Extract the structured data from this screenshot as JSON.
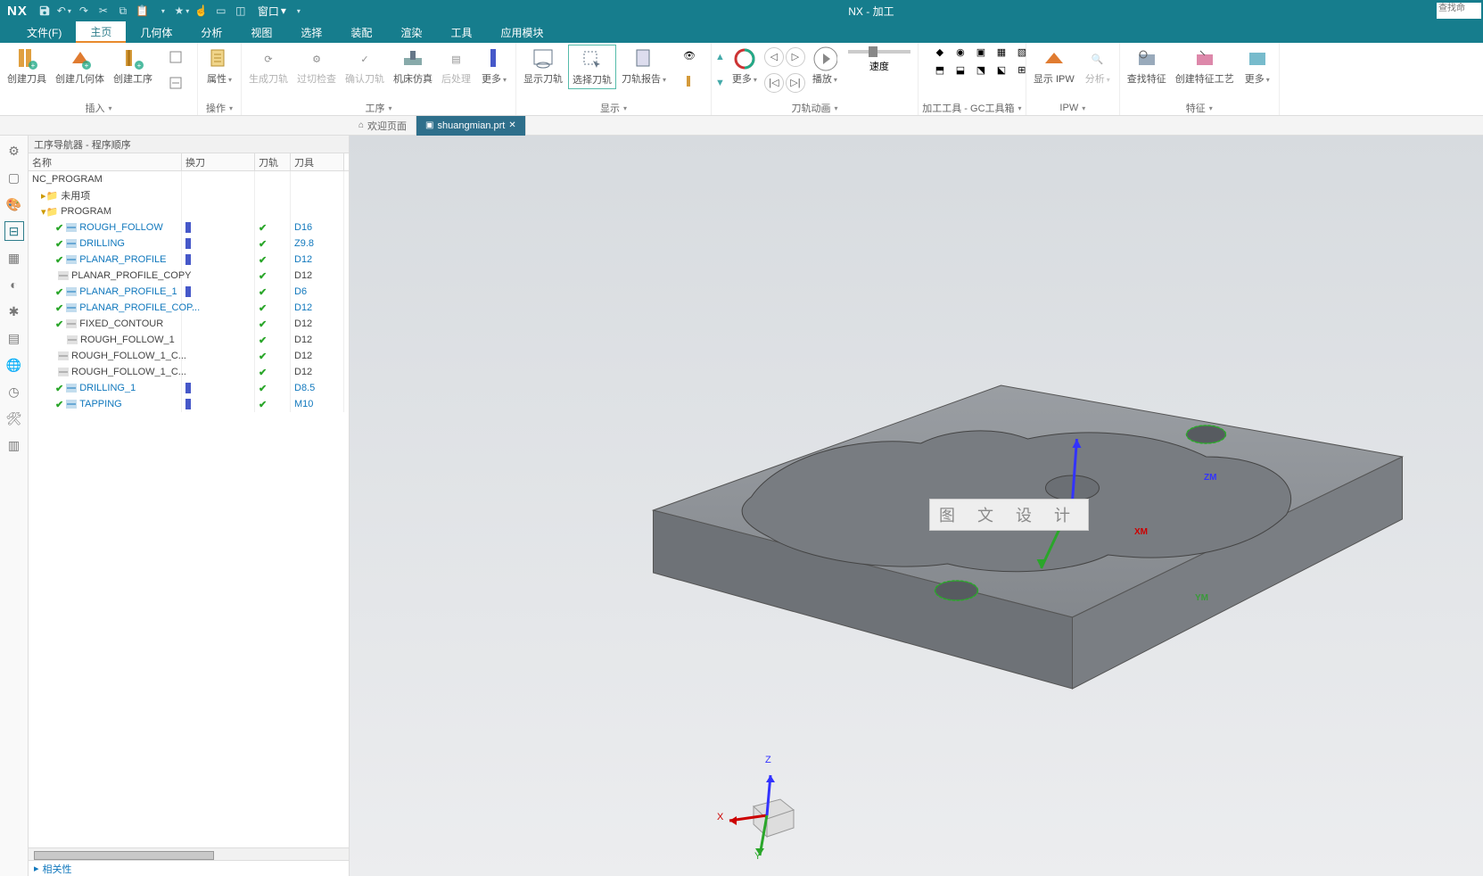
{
  "title": "NX - 加工",
  "nx_logo": "NX",
  "window_dropdown": "窗口",
  "search_placeholder": "查找命",
  "menus": [
    "文件(F)",
    "主页",
    "几何体",
    "分析",
    "视图",
    "选择",
    "装配",
    "渲染",
    "工具",
    "应用模块"
  ],
  "ribbon_groups": {
    "insert": {
      "label": "插入",
      "create_tool": "创建刀具",
      "create_geom": "创建几何体",
      "create_op": "创建工序"
    },
    "action": {
      "label": "操作",
      "props": "属性"
    },
    "ops": {
      "label": "工序",
      "gen": "生成刀轨",
      "gouge": "过切检查",
      "verify": "确认刀轨",
      "sim": "机床仿真",
      "post": "后处理",
      "more": "更多"
    },
    "display": {
      "label": "显示",
      "show_tp": "显示刀轨",
      "select_tp": "选择刀轨",
      "tp_report": "刀轨报告"
    },
    "anim": {
      "label": "刀轨动画",
      "more": "更多",
      "speed": "速度",
      "play": "播放"
    },
    "gctools": {
      "label": "加工工具 - GC工具箱"
    },
    "ipw": {
      "label": "IPW",
      "show_ipw": "显示 IPW",
      "analyze": "分析"
    },
    "feature": {
      "label": "特征",
      "find": "查找特征",
      "teach": "创建特征工艺",
      "more": "更多"
    }
  },
  "tabs": {
    "welcome": "欢迎页面",
    "active": "shuangmian.prt"
  },
  "navigator": {
    "title": "工序导航器 - 程序顺序",
    "cols": {
      "name": "名称",
      "toolchange": "换刀",
      "toolpath": "刀轨",
      "tool": "刀具"
    },
    "root": "NC_PROGRAM",
    "unused": "未用项",
    "program": "PROGRAM",
    "rows": [
      {
        "name": "ROUGH_FOLLOW",
        "tc": true,
        "tp": true,
        "tool": "D16",
        "link": true,
        "chk": true
      },
      {
        "name": "DRILLING",
        "tc": true,
        "tp": true,
        "tool": "Z9.8",
        "link": true,
        "chk": true
      },
      {
        "name": "PLANAR_PROFILE",
        "tc": true,
        "tp": true,
        "tool": "D12",
        "link": true,
        "chk": true
      },
      {
        "name": "PLANAR_PROFILE_COPY",
        "tc": false,
        "tp": true,
        "tool": "D12",
        "link": false,
        "chk": false
      },
      {
        "name": "PLANAR_PROFILE_1",
        "tc": true,
        "tp": true,
        "tool": "D6",
        "link": true,
        "chk": true
      },
      {
        "name": "PLANAR_PROFILE_COP...",
        "tc": false,
        "tp": true,
        "tool": "D12",
        "link": true,
        "chk": true
      },
      {
        "name": "FIXED_CONTOUR",
        "tc": false,
        "tp": true,
        "tool": "D12",
        "link": false,
        "chk": true
      },
      {
        "name": "ROUGH_FOLLOW_1",
        "tc": false,
        "tp": true,
        "tool": "D12",
        "link": false,
        "chk": false
      },
      {
        "name": "ROUGH_FOLLOW_1_C...",
        "tc": false,
        "tp": true,
        "tool": "D12",
        "link": false,
        "chk": false
      },
      {
        "name": "ROUGH_FOLLOW_1_C...",
        "tc": false,
        "tp": true,
        "tool": "D12",
        "link": false,
        "chk": false
      },
      {
        "name": "DRILLING_1",
        "tc": true,
        "tp": true,
        "tool": "D8.5",
        "link": true,
        "chk": true
      },
      {
        "name": "TAPPING",
        "tc": true,
        "tp": true,
        "tool": "M10",
        "link": true,
        "chk": true
      }
    ],
    "related": "相关性"
  },
  "viewport": {
    "watermark": "图 文 设 计",
    "xm": "XM",
    "ym": "YM",
    "zm": "ZM",
    "x": "X",
    "y": "Y",
    "z": "Z"
  }
}
